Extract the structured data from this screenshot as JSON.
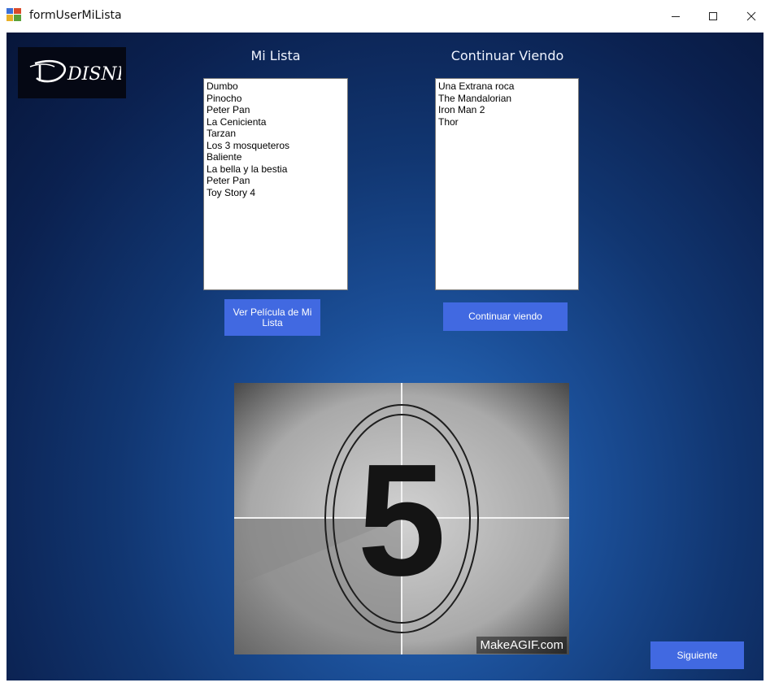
{
  "window": {
    "title": "formUserMiLista"
  },
  "logo": {
    "text": "DISNEY"
  },
  "mi_lista": {
    "title": "Mi Lista",
    "items": [
      "Dumbo",
      "Pinocho",
      "Peter Pan",
      "La Cenicienta",
      "Tarzan",
      "Los 3 mosqueteros",
      "Baliente",
      "La bella y la bestia",
      "Peter Pan",
      "Toy Story 4"
    ],
    "button_label": "Ver Película de Mi Lista"
  },
  "continuar": {
    "title": "Continuar Viendo",
    "items": [
      "Una Extrana roca",
      "The Mandalorian",
      "Iron Man 2",
      "Thor"
    ],
    "button_label": "Continuar viendo"
  },
  "countdown": {
    "number": "5",
    "watermark": "MakeAGIF.com"
  },
  "footer": {
    "next_label": "Siguiente"
  },
  "colors": {
    "button": "#4169e1",
    "background_dark": "#07163a",
    "background_light": "#2c74c7"
  }
}
